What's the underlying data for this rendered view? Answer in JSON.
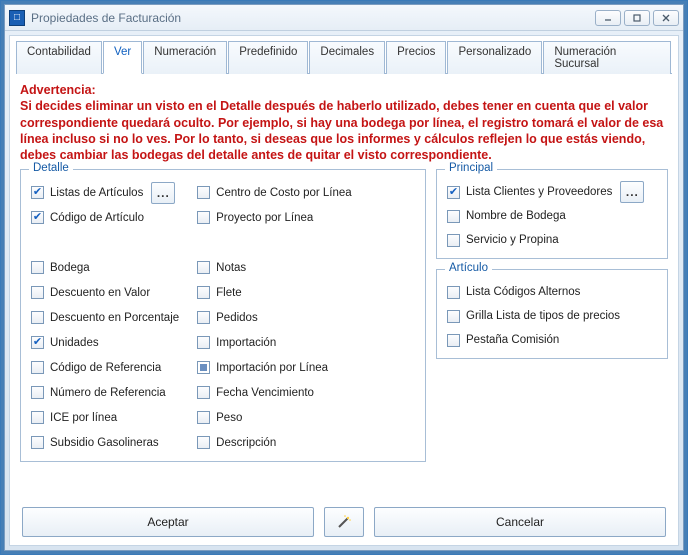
{
  "window": {
    "title": "Propiedades de Facturación"
  },
  "tabs": [
    {
      "label": "Contabilidad"
    },
    {
      "label": "Ver"
    },
    {
      "label": "Numeración"
    },
    {
      "label": "Predefinido"
    },
    {
      "label": "Decimales"
    },
    {
      "label": "Precios"
    },
    {
      "label": "Personalizado"
    },
    {
      "label": "Numeración Sucursal"
    }
  ],
  "warning": {
    "title": "Advertencia:",
    "body": "Si decides eliminar un visto en el Detalle después de haberlo utilizado, debes tener en cuenta que el valor correspondiente quedará oculto. Por ejemplo, si hay una bodega por línea, el registro tomará el valor de esa línea incluso si no lo ves. Por lo tanto, si deseas que los informes y cálculos reflejen lo que estás viendo, debes cambiar las bodegas del detalle antes de quitar el visto correspondiente."
  },
  "detalle": {
    "legend": "Detalle",
    "more_button": "...",
    "col1": [
      {
        "label": "Listas de Artículos",
        "state": "checked"
      },
      {
        "label": "Código de Artículo",
        "state": "checked"
      },
      null,
      {
        "label": "Bodega",
        "state": ""
      },
      {
        "label": "Descuento en Valor",
        "state": ""
      },
      {
        "label": "Descuento en Porcentaje",
        "state": ""
      },
      {
        "label": "Unidades",
        "state": "checked"
      },
      {
        "label": "Código de Referencia",
        "state": ""
      },
      {
        "label": "Número de Referencia",
        "state": ""
      },
      {
        "label": "ICE por línea",
        "state": ""
      },
      {
        "label": "Subsidio Gasolineras",
        "state": ""
      }
    ],
    "col2": [
      {
        "label": "Centro de Costo por Línea",
        "state": ""
      },
      {
        "label": "Proyecto por Línea",
        "state": ""
      },
      null,
      {
        "label": "Notas",
        "state": ""
      },
      {
        "label": "Flete",
        "state": ""
      },
      {
        "label": "Pedidos",
        "state": ""
      },
      {
        "label": "Importación",
        "state": ""
      },
      {
        "label": "Importación por Línea",
        "state": "filled"
      },
      {
        "label": "Fecha Vencimiento",
        "state": ""
      },
      {
        "label": "Peso",
        "state": ""
      },
      {
        "label": "Descripción",
        "state": ""
      }
    ]
  },
  "principal": {
    "legend": "Principal",
    "more_button": "...",
    "items": [
      {
        "label": "Lista Clientes y Proveedores",
        "state": "checked"
      },
      {
        "label": "Nombre de Bodega",
        "state": ""
      },
      {
        "label": "Servicio y Propina",
        "state": ""
      }
    ]
  },
  "articulo": {
    "legend": "Artículo",
    "items": [
      {
        "label": "Lista Códigos Alternos",
        "state": ""
      },
      {
        "label": "Grilla Lista de tipos de precios",
        "state": ""
      },
      {
        "label": "Pestaña Comisión",
        "state": ""
      }
    ]
  },
  "buttons": {
    "accept": "Aceptar",
    "cancel": "Cancelar"
  }
}
